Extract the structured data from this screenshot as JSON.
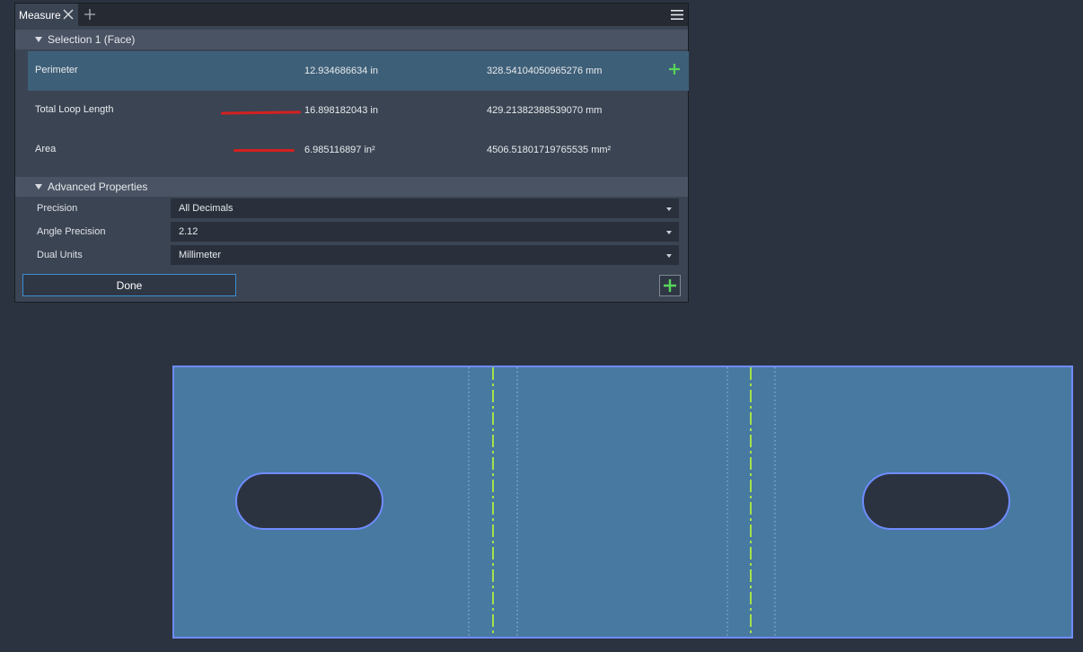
{
  "tab": {
    "label": "Measure"
  },
  "selection": {
    "header": "Selection 1 (Face)",
    "rows": [
      {
        "label": "Perimeter",
        "value_in": "12.934686634 in",
        "value_mm": "328.54104050965276 mm"
      },
      {
        "label": "Total Loop Length",
        "value_in": "16.898182043 in",
        "value_mm": "429.21382388539070 mm"
      },
      {
        "label": "Area",
        "value_in": "6.985116897 in²",
        "value_mm": "4506.51801719765535 mm²"
      }
    ]
  },
  "advanced": {
    "header": "Advanced Properties",
    "properties": [
      {
        "label": "Precision",
        "value": "All Decimals"
      },
      {
        "label": "Angle Precision",
        "value": "2.12"
      },
      {
        "label": "Dual Units",
        "value": "Millimeter"
      }
    ]
  },
  "buttons": {
    "done": "Done"
  },
  "colors": {
    "face_fill": "#4779a1",
    "face_edge": "#6f8cff",
    "bend_line": "#a6e14c",
    "plus_green": "#57d65a",
    "annotation_red": "#d42020"
  },
  "icons": [
    "close-icon",
    "plus-icon",
    "hamburger-menu-icon",
    "triangle-down-icon"
  ]
}
